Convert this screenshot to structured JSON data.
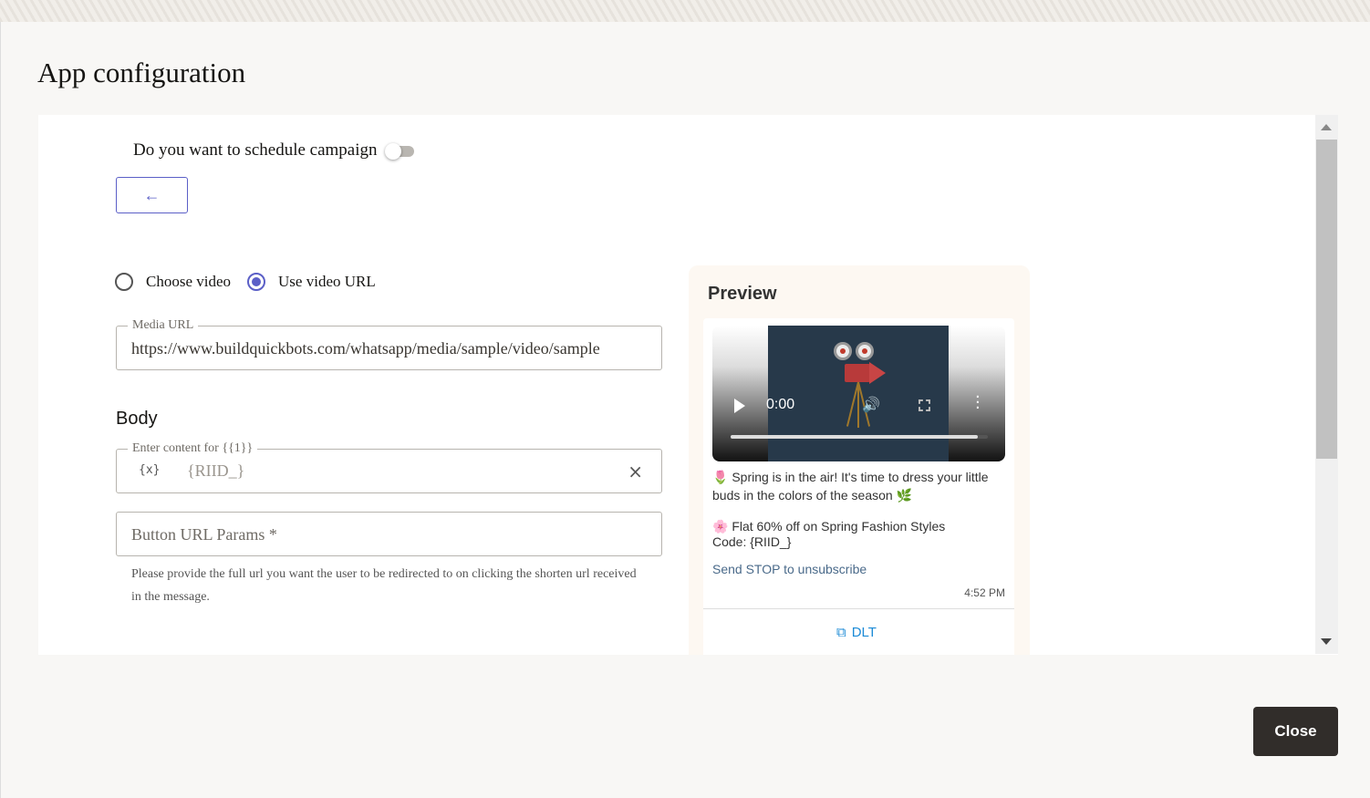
{
  "dialog": {
    "title": "App configuration",
    "close_label": "Close"
  },
  "schedule": {
    "label": "Do you want to schedule campaign",
    "enabled": false
  },
  "back_button": {
    "icon": "arrow-left-icon",
    "label": "←"
  },
  "video_source": {
    "options": [
      {
        "label": "Choose video",
        "selected": false
      },
      {
        "label": "Use video URL",
        "selected": true
      }
    ]
  },
  "media_url": {
    "legend": "Media URL",
    "value": "https://www.buildquickbots.com/whatsapp/media/sample/video/sample"
  },
  "body": {
    "heading": "Body",
    "legend": "Enter content for {{1}}",
    "var_icon": "{x}",
    "value": "{RIID_}",
    "clear_icon": "×"
  },
  "button_url": {
    "placeholder": "Button URL Params *",
    "help": "Please provide the full url you want the user to be redirected to on clicking the shorten url received in the message."
  },
  "preview": {
    "title": "Preview",
    "video_time": "0:00",
    "video_progress": 0.96,
    "message_line1": "🌷 Spring is in the air! It's time to dress your little buds in the colors of the season 🌿",
    "message_line2": "🌸 Flat 60% off on Spring Fashion Styles",
    "message_line3": "Code: {RIID_}",
    "unsubscribe": "Send STOP to unsubscribe",
    "timestamp": "4:52 PM",
    "button_label": "DLT",
    "button_icon": "external-link-icon"
  },
  "colors": {
    "accent": "#5b5fc7",
    "close_button": "#312d2a",
    "link": "#1b8ad6"
  }
}
